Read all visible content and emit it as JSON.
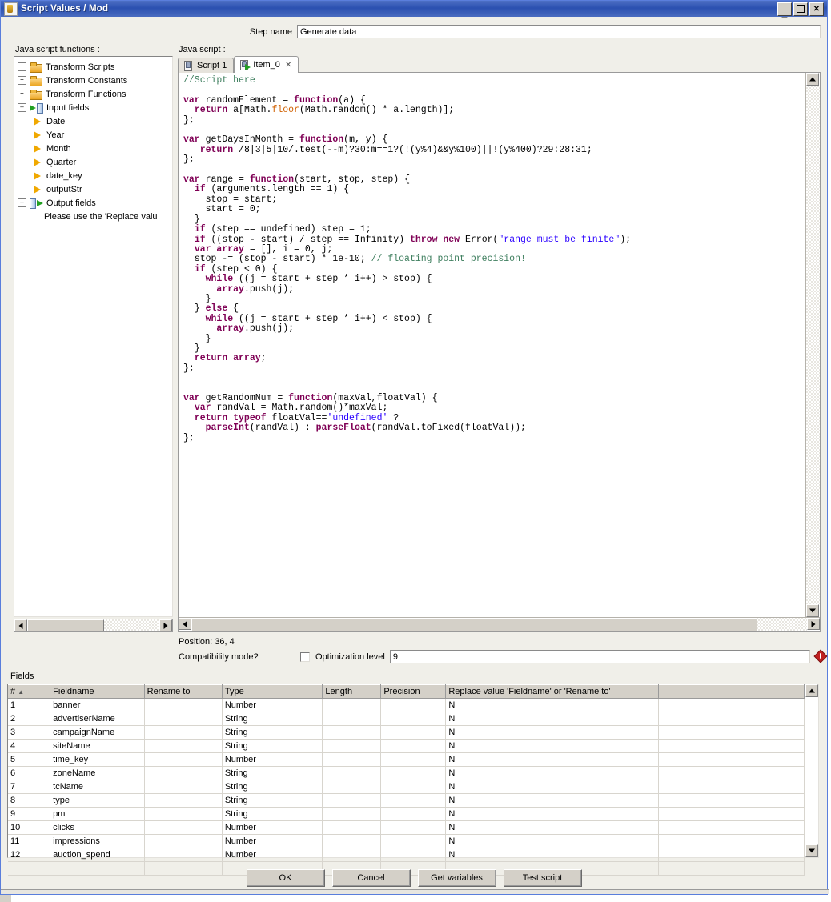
{
  "window": {
    "title": "Script Values / Mod",
    "icon": "script-file-icon",
    "controls": {
      "minimize": "_",
      "maximize": "□",
      "close": "✕"
    }
  },
  "step": {
    "label": "Step name",
    "value": "Generate data",
    "placeholder": ""
  },
  "panels": {
    "tree_label": "Java script functions :",
    "editor_label": "Java script :"
  },
  "tree": {
    "items": [
      {
        "label": "Transform Scripts",
        "icon": "folder-icon",
        "expander": "+",
        "indent": 0
      },
      {
        "label": "Transform Constants",
        "icon": "folder-icon",
        "expander": "+",
        "indent": 0
      },
      {
        "label": "Transform Functions",
        "icon": "folder-icon",
        "expander": "+",
        "indent": 0
      },
      {
        "label": "Input fields",
        "icon": "input-fields-icon",
        "expander": "-",
        "indent": 0
      },
      {
        "label": "Date",
        "icon": "field-arrow-icon",
        "expander": "",
        "indent": 1
      },
      {
        "label": "Year",
        "icon": "field-arrow-icon",
        "expander": "",
        "indent": 1
      },
      {
        "label": "Month",
        "icon": "field-arrow-icon",
        "expander": "",
        "indent": 1
      },
      {
        "label": "Quarter",
        "icon": "field-arrow-icon",
        "expander": "",
        "indent": 1
      },
      {
        "label": "date_key",
        "icon": "field-arrow-icon",
        "expander": "",
        "indent": 1
      },
      {
        "label": "outputStr",
        "icon": "field-arrow-icon",
        "expander": "",
        "indent": 1
      },
      {
        "label": "Output fields",
        "icon": "output-fields-icon",
        "expander": "-",
        "indent": 0
      },
      {
        "label": "Please use the 'Replace valu",
        "icon": "none",
        "expander": "",
        "indent": 2
      }
    ]
  },
  "editor": {
    "tabs": [
      {
        "label": "Script 1",
        "active": false,
        "closable": false,
        "icon": "script-tab-icon"
      },
      {
        "label": "Item_0",
        "active": true,
        "closable": true,
        "icon": "item-tab-icon",
        "close": "✕"
      }
    ],
    "code_lines": [
      "//Script here",
      "",
      "var randomElement = function(a) {",
      "  return a[Math.floor(Math.random() * a.length)];",
      "};",
      "",
      "var getDaysInMonth = function(m, y) {",
      "   return /8|3|5|10/.test(--m)?30:m==1?(!(y%4)&&y%100)||!(y%400)?29:28:31;",
      "};",
      "",
      "var range = function(start, stop, step) {",
      "  if (arguments.length == 1) {",
      "    stop = start;",
      "    start = 0;",
      "  }",
      "  if (step == undefined) step = 1;",
      "  if ((stop - start) / step == Infinity) throw new Error(\"range must be finite\");",
      "  var array = [], i = 0, j;",
      "  stop -= (stop - start) * 1e-10; // floating point precision!",
      "  if (step < 0) {",
      "    while ((j = start + step * i++) > stop) {",
      "      array.push(j);",
      "    }",
      "  } else {",
      "    while ((j = start + step * i++) < stop) {",
      "      array.push(j);",
      "    }",
      "  }",
      "  return array;",
      "};",
      "",
      "",
      "var getRandomNum = function(maxVal,floatVal) {",
      "  var randVal = Math.random()*maxVal;",
      "  return typeof floatVal=='undefined' ?",
      "    parseInt(randVal) : parseFloat(randVal.toFixed(floatVal));",
      "};"
    ]
  },
  "status": {
    "position": "Position: 36, 4",
    "compatibility_label": "Compatibility mode?",
    "compatibility_checked": false,
    "optimization_label": "Optimization level",
    "optimization_value": "9",
    "warning_icon": "red-diamond-icon"
  },
  "fields": {
    "section_label": "Fields",
    "columns": [
      "#",
      "Fieldname",
      "Rename to",
      "Type",
      "Length",
      "Precision",
      "Replace value 'Fieldname' or 'Rename to'",
      ""
    ],
    "sort_indicator": "▲",
    "rows": [
      {
        "num": "1",
        "fieldname": "banner",
        "rename_to": "",
        "type": "Number",
        "length": "",
        "precision": "",
        "replace": "N",
        "extra": ""
      },
      {
        "num": "2",
        "fieldname": "advertiserName",
        "rename_to": "",
        "type": "String",
        "length": "",
        "precision": "",
        "replace": "N",
        "extra": ""
      },
      {
        "num": "3",
        "fieldname": "campaignName",
        "rename_to": "",
        "type": "String",
        "length": "",
        "precision": "",
        "replace": "N",
        "extra": ""
      },
      {
        "num": "4",
        "fieldname": "siteName",
        "rename_to": "",
        "type": "String",
        "length": "",
        "precision": "",
        "replace": "N",
        "extra": ""
      },
      {
        "num": "5",
        "fieldname": "time_key",
        "rename_to": "",
        "type": "Number",
        "length": "",
        "precision": "",
        "replace": "N",
        "extra": ""
      },
      {
        "num": "6",
        "fieldname": "zoneName",
        "rename_to": "",
        "type": "String",
        "length": "",
        "precision": "",
        "replace": "N",
        "extra": ""
      },
      {
        "num": "7",
        "fieldname": "tcName",
        "rename_to": "",
        "type": "String",
        "length": "",
        "precision": "",
        "replace": "N",
        "extra": ""
      },
      {
        "num": "8",
        "fieldname": "type",
        "rename_to": "",
        "type": "String",
        "length": "",
        "precision": "",
        "replace": "N",
        "extra": ""
      },
      {
        "num": "9",
        "fieldname": "pm",
        "rename_to": "",
        "type": "String",
        "length": "",
        "precision": "",
        "replace": "N",
        "extra": ""
      },
      {
        "num": "10",
        "fieldname": "clicks",
        "rename_to": "",
        "type": "Number",
        "length": "",
        "precision": "",
        "replace": "N",
        "extra": ""
      },
      {
        "num": "11",
        "fieldname": "impressions",
        "rename_to": "",
        "type": "Number",
        "length": "",
        "precision": "",
        "replace": "N",
        "extra": ""
      },
      {
        "num": "12",
        "fieldname": "auction_spend",
        "rename_to": "",
        "type": "Number",
        "length": "",
        "precision": "",
        "replace": "N",
        "extra": ""
      }
    ]
  },
  "buttons": [
    {
      "label": "OK",
      "name": "ok-button"
    },
    {
      "label": "Cancel",
      "name": "cancel-button"
    },
    {
      "label": "Get variables",
      "name": "get-variables-button"
    },
    {
      "label": "Test script",
      "name": "test-script-button"
    }
  ],
  "colors": {
    "title_bar": "#2b50b0",
    "dialog_bg": "#f0efe9",
    "keyword": "#7f0055",
    "comment": "#3f7f5f",
    "string": "#2a00ff",
    "function": "#d06000",
    "warning": "#c02020"
  }
}
